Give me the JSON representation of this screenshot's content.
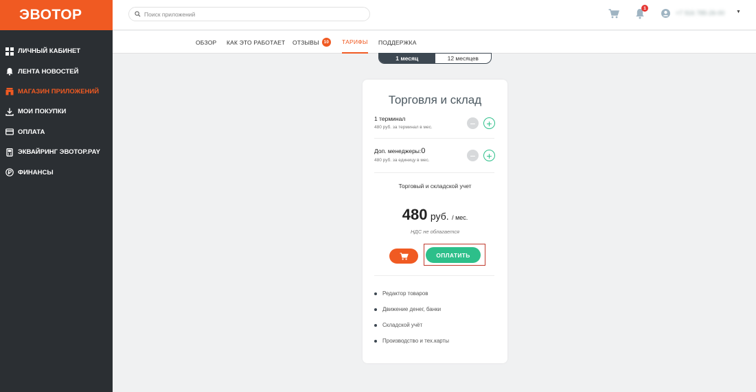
{
  "brand": {
    "logo": "ЭВОТОР",
    "accent": "#f05a22",
    "green": "#2dbf8a",
    "sidebar_bg": "#2b2f33"
  },
  "sidebar": {
    "items": [
      {
        "label": "ЛИЧНЫЙ КАБИНЕТ",
        "icon": "grid-icon"
      },
      {
        "label": "ЛЕНТА НОВОСТЕЙ",
        "icon": "bell-icon"
      },
      {
        "label": "МАГАЗИН ПРИЛОЖЕНИЙ",
        "icon": "store-icon",
        "active": true
      },
      {
        "label": "МОИ ПОКУПКИ",
        "icon": "download-icon"
      },
      {
        "label": "ОПЛАТА",
        "icon": "card-icon"
      },
      {
        "label": "ЭКВАЙРИНГ ЭВОТОР.PAY",
        "icon": "terminal-icon"
      },
      {
        "label": "ФИНАНСЫ",
        "icon": "ruble-icon"
      }
    ]
  },
  "header": {
    "search_placeholder": "Поиск приложений",
    "notifications_count": "1",
    "phone": "+7 916 785-26-00"
  },
  "tabs": [
    {
      "label": "ОБЗОР"
    },
    {
      "label": "КАК ЭТО РАБОТАЕТ"
    },
    {
      "label": "ОТЗЫВЫ",
      "badge": "10"
    },
    {
      "label": "ТАРИФЫ",
      "active": true
    },
    {
      "label": "ПОДДЕРЖКА"
    }
  ],
  "period_toggle": {
    "options": [
      "1 месяц",
      "12 месяцев"
    ],
    "selected": "1 месяц"
  },
  "tariff": {
    "title": "Торговля и склад",
    "terminals_label": "1 терминал",
    "terminals_sub": "480 руб. за терминал в мес.",
    "managers_label": "Доп. менеджеры:",
    "managers_value": "0",
    "managers_sub": "480 руб. за единицу в мес.",
    "feature": "Торговый и складской учет",
    "price": "480",
    "currency": "руб.",
    "period": "/ мес.",
    "vat": "НДС не облагается",
    "pay_label": "ОПЛАТИТЬ",
    "bullets": [
      "Редактор товаров",
      "Движение денег, банки",
      "Складской учёт",
      "Производство и тех.карты"
    ]
  }
}
